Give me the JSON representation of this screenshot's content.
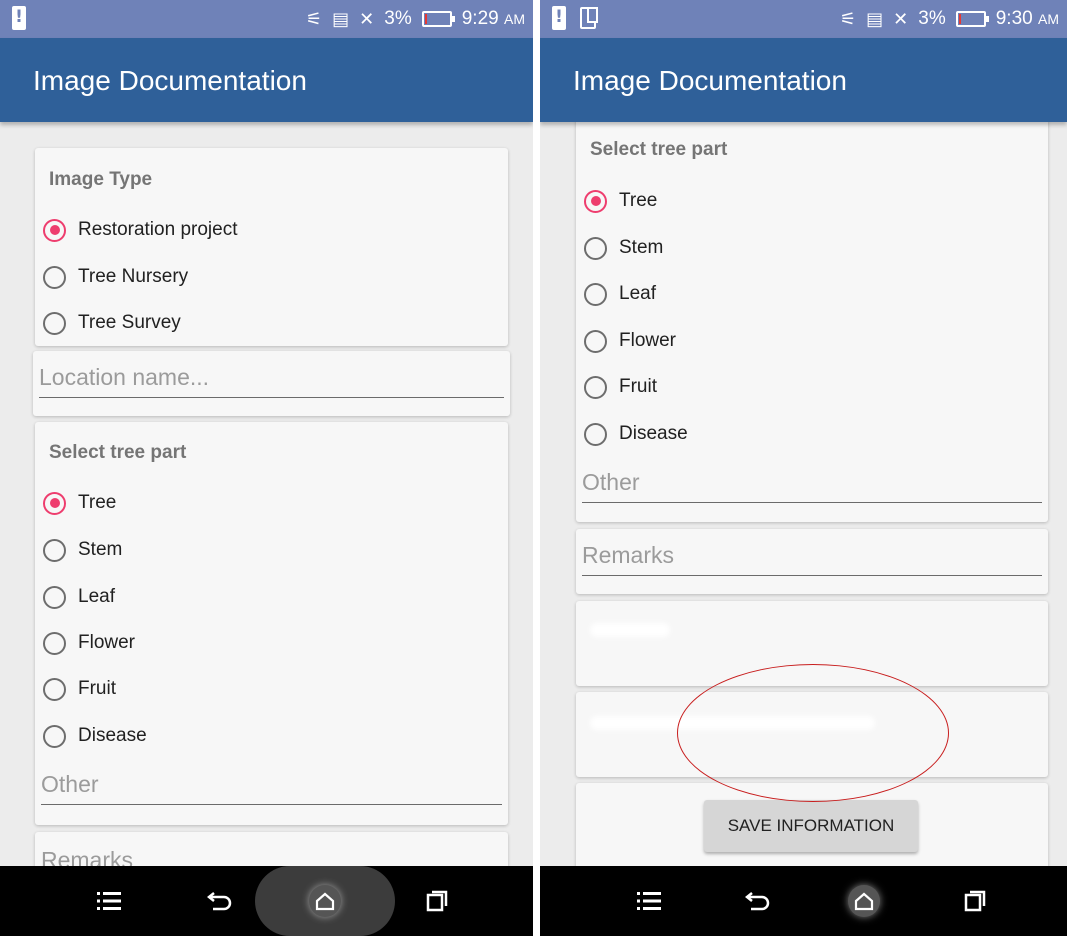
{
  "app_title": "Image Documentation",
  "left": {
    "status": {
      "battery_pct": "3%",
      "time": "9:29",
      "ampm": "AM"
    },
    "image_type": {
      "title": "Image Type",
      "options": [
        "Restoration project",
        "Tree Nursery",
        "Tree Survey"
      ],
      "selected": "Restoration project"
    },
    "location_placeholder": "Location name...",
    "tree_part": {
      "title": "Select tree part",
      "options": [
        "Tree",
        "Stem",
        "Leaf",
        "Flower",
        "Fruit",
        "Disease"
      ],
      "selected": "Tree"
    },
    "other_placeholder": "Other",
    "remarks_placeholder": "Remarks"
  },
  "right": {
    "status": {
      "battery_pct": "3%",
      "time": "9:30",
      "ampm": "AM"
    },
    "tree_part": {
      "title": "Select tree part",
      "options": [
        "Tree",
        "Stem",
        "Leaf",
        "Flower",
        "Fruit",
        "Disease"
      ],
      "selected": "Tree"
    },
    "other_placeholder": "Other",
    "remarks_placeholder": "Remarks",
    "save_button": "SAVE INFORMATION"
  },
  "colors": {
    "status_bar": "#6f82b8",
    "app_bar": "#2f6099",
    "radio_accent": "#ee3d6e",
    "annotation": "#c81e1e"
  },
  "icons": {
    "nav": [
      "menu-icon",
      "back-icon",
      "home-icon",
      "recents-icon"
    ],
    "status": [
      "battery-alert-icon",
      "dual-screen-icon",
      "hotspot-icon",
      "sim-icon",
      "signal-icon",
      "battery-icon"
    ]
  }
}
